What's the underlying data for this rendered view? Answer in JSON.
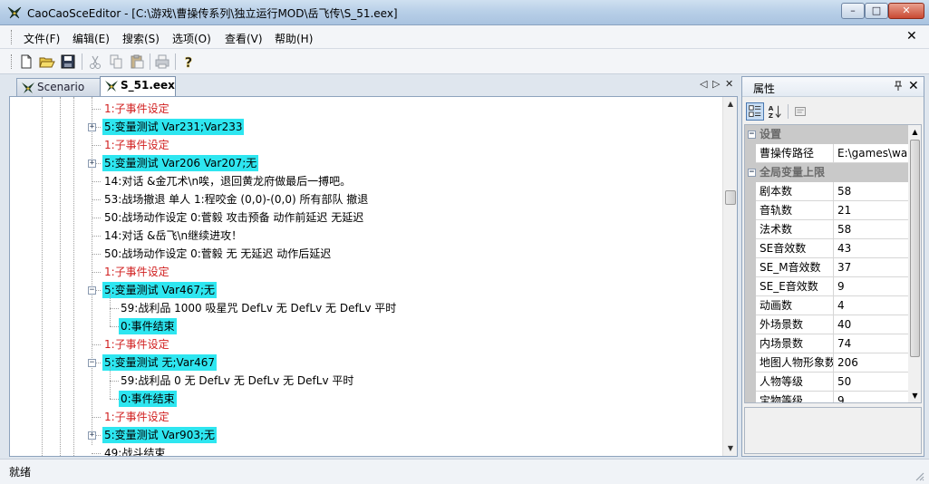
{
  "window": {
    "title": "CaoCaoSceEditor - [C:\\游戏\\曹操传系列\\独立运行MOD\\岳飞传\\S_51.eex]",
    "min_glyph": "–",
    "max_glyph": "□",
    "close_glyph": "✕",
    "icon": "cao-cao-app-icon"
  },
  "menu": {
    "items": [
      "文件(F)",
      "编辑(E)",
      "搜索(S)",
      "选项(O)",
      "查看(V)",
      "帮助(H)"
    ],
    "close_glyph": "✕"
  },
  "toolbar": {
    "buttons": [
      "new-file-icon",
      "open-folder-icon",
      "save-icon",
      "cut-icon",
      "copy-icon",
      "paste-icon",
      "print-icon",
      "help-icon"
    ]
  },
  "tabs": {
    "items": [
      {
        "label": "Scenario",
        "active": false
      },
      {
        "label": "S_51.eex",
        "active": true
      }
    ],
    "nav_prev": "◁",
    "nav_next": "▷",
    "close_glyph": "✕"
  },
  "tree": {
    "rows": [
      {
        "text": "1:子事件设定",
        "style": "red",
        "level": 0,
        "expander": ""
      },
      {
        "text": "5:变量测试 Var231;Var233",
        "style": "hl",
        "level": 0,
        "expander": "+"
      },
      {
        "text": "1:子事件设定",
        "style": "red",
        "level": 0,
        "expander": ""
      },
      {
        "text": "5:变量测试 Var206 Var207;无",
        "style": "hl",
        "level": 0,
        "expander": "+"
      },
      {
        "text": "14:对话 &金兀术\\n唉，退回黄龙府做最后一搏吧。",
        "style": "normal",
        "level": 0,
        "expander": ""
      },
      {
        "text": "53:战场撤退 单人 1:程咬金 (0,0)-(0,0) 所有部队 撤退",
        "style": "normal",
        "level": 0,
        "expander": ""
      },
      {
        "text": "50:战场动作设定 0:菅毅 攻击预备 动作前延迟 无延迟",
        "style": "normal",
        "level": 0,
        "expander": ""
      },
      {
        "text": "14:对话 &岳飞\\n继续进攻！",
        "style": "normal",
        "level": 0,
        "expander": ""
      },
      {
        "text": "50:战场动作设定 0:菅毅 无 无延迟 动作后延迟",
        "style": "normal",
        "level": 0,
        "expander": ""
      },
      {
        "text": "1:子事件设定",
        "style": "red",
        "level": 0,
        "expander": ""
      },
      {
        "text": "5:变量测试 Var467;无",
        "style": "hl",
        "level": 0,
        "expander": "−"
      },
      {
        "text": "59:战利品 1000 吸星咒 DefLv 无 DefLv 无 DefLv 平时",
        "style": "normal",
        "level": 1,
        "expander": ""
      },
      {
        "text": "0:事件结束",
        "style": "hl",
        "level": 1,
        "expander": ""
      },
      {
        "text": "1:子事件设定",
        "style": "red",
        "level": 0,
        "expander": ""
      },
      {
        "text": "5:变量测试 无;Var467",
        "style": "hl",
        "level": 0,
        "expander": "−"
      },
      {
        "text": "59:战利品 0 无 DefLv 无 DefLv 无 DefLv 平时",
        "style": "normal",
        "level": 1,
        "expander": ""
      },
      {
        "text": "0:事件结束",
        "style": "hl",
        "level": 1,
        "expander": ""
      },
      {
        "text": "1:子事件设定",
        "style": "red",
        "level": 0,
        "expander": ""
      },
      {
        "text": "5:变量测试 Var903;无",
        "style": "hl",
        "level": 0,
        "expander": "+"
      },
      {
        "text": "49:战斗结束",
        "style": "normal",
        "level": 0,
        "expander": ""
      }
    ],
    "scroll_position": 0.25,
    "colors": {
      "highlight": "#2ee6f0",
      "red": "#d12020"
    }
  },
  "properties": {
    "title": "属性",
    "pin_glyph": "ꟷ",
    "close_glyph": "✕",
    "toolbar": [
      "categorized-icon",
      "alphabetical-sort-icon",
      "property-pages-icon"
    ],
    "categories": [
      {
        "name": "设置",
        "rows": [
          {
            "name": "曹操传路径",
            "value": "E:\\games\\wa"
          }
        ]
      },
      {
        "name": "全局变量上限",
        "rows": [
          {
            "name": "剧本数",
            "value": "58"
          },
          {
            "name": "音轨数",
            "value": "21"
          },
          {
            "name": "法术数",
            "value": "58"
          },
          {
            "name": "SE音效数",
            "value": "43"
          },
          {
            "name": "SE_M音效数",
            "value": "37"
          },
          {
            "name": "SE_E音效数",
            "value": "9"
          },
          {
            "name": "动画数",
            "value": "4"
          },
          {
            "name": "外场景数",
            "value": "40"
          },
          {
            "name": "内场景数",
            "value": "74"
          },
          {
            "name": "地图人物形象数",
            "value": "206"
          },
          {
            "name": "人物等级",
            "value": "50"
          },
          {
            "name": "宝物等级",
            "value": "9"
          }
        ]
      }
    ]
  },
  "status": {
    "text": "就绪"
  }
}
